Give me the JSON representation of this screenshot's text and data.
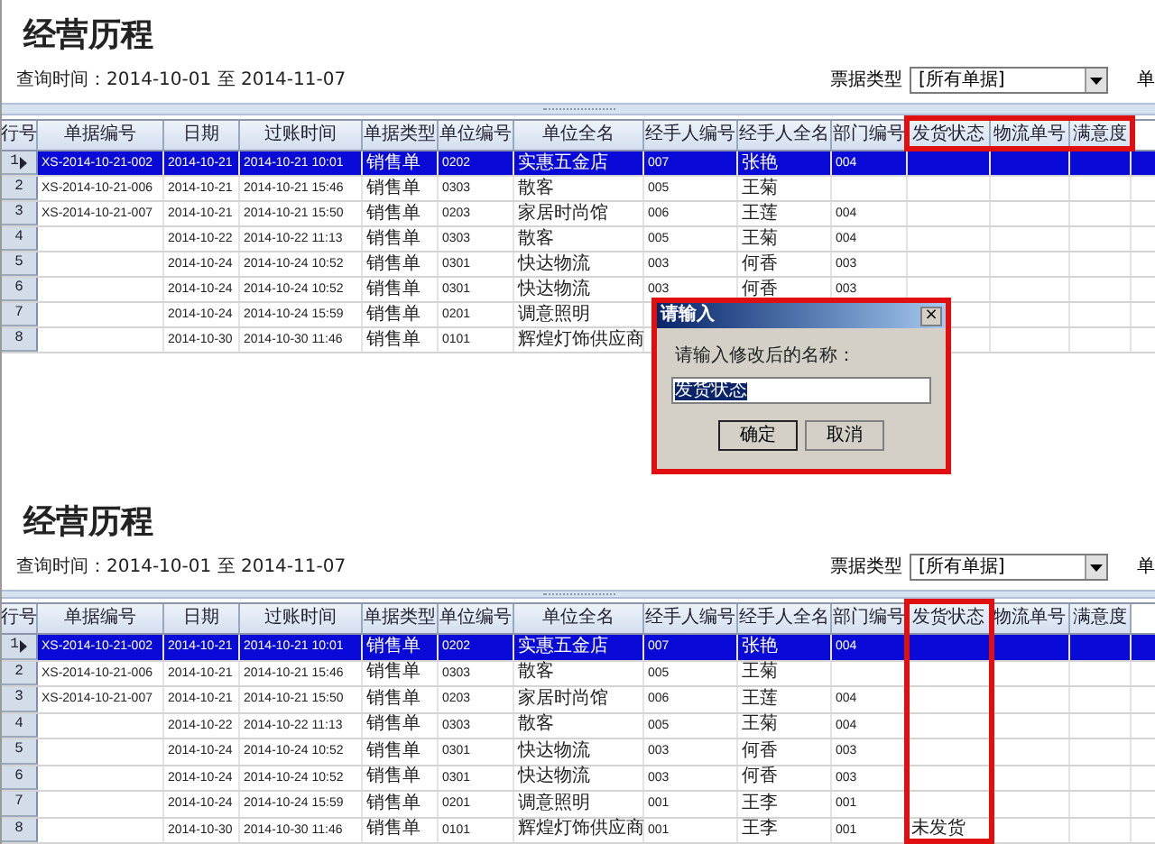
{
  "panels": [
    {
      "title": "经营历程",
      "query": "查询时间：2014-10-01 至 2014-11-07",
      "filter": {
        "label": "票据类型",
        "value": "[所有单据]"
      },
      "cut_label": "单",
      "highlight_covers_rows": false,
      "columns": [
        {
          "label": "行号",
          "highlighted": false
        },
        {
          "label": "单据编号",
          "highlighted": false
        },
        {
          "label": "日期",
          "highlighted": false
        },
        {
          "label": "过账时间",
          "highlighted": false
        },
        {
          "label": "单据类型",
          "highlighted": false
        },
        {
          "label": "单位编号",
          "highlighted": false
        },
        {
          "label": "单位全名",
          "highlighted": false
        },
        {
          "label": "经手人编号",
          "highlighted": false
        },
        {
          "label": "经手人全名",
          "highlighted": false
        },
        {
          "label": "部门编号",
          "highlighted": false
        },
        {
          "label": "发货状态",
          "highlighted": true
        },
        {
          "label": "物流单号",
          "highlighted": true
        },
        {
          "label": "满意度",
          "highlighted": true
        }
      ],
      "rows": [
        {
          "selected": true,
          "cells": [
            "1",
            "XS-2014-10-21-002",
            "2014-10-21",
            "2014-10-21 10:01",
            "销售单",
            "0202",
            "实惠五金店",
            "007",
            "张艳",
            "004"
          ]
        },
        {
          "selected": false,
          "cells": [
            "2",
            "XS-2014-10-21-006",
            "2014-10-21",
            "2014-10-21 15:46",
            "销售单",
            "0303",
            "散客",
            "005",
            "王菊"
          ]
        },
        {
          "selected": false,
          "cells": [
            "3",
            "XS-2014-10-21-007",
            "2014-10-21",
            "2014-10-21 15:50",
            "销售单",
            "0203",
            "家居时尚馆",
            "006",
            "王莲",
            "004"
          ]
        },
        {
          "selected": false,
          "cells": [
            "4",
            null,
            "2014-10-22",
            "2014-10-22 11:13",
            "销售单",
            "0303",
            "散客",
            "005",
            "王菊",
            "004"
          ]
        },
        {
          "selected": false,
          "cells": [
            "5",
            null,
            "2014-10-24",
            "2014-10-24 10:52",
            "销售单",
            "0301",
            "快达物流",
            "003",
            "何香",
            "003"
          ]
        },
        {
          "selected": false,
          "cells": [
            "6",
            null,
            "2014-10-24",
            "2014-10-24 10:52",
            "销售单",
            "0301",
            "快达物流",
            "003",
            "何香",
            "003"
          ]
        },
        {
          "selected": false,
          "cells": [
            "7",
            null,
            "2014-10-24",
            "2014-10-24 15:59",
            "销售单",
            "0201",
            "调意照明"
          ]
        },
        {
          "selected": false,
          "cells": [
            "8",
            null,
            "2014-10-30",
            "2014-10-30 11:46",
            "销售单",
            "0101",
            "辉煌灯饰供应商"
          ]
        }
      ],
      "dialog": {
        "title": "请输入",
        "close": "×",
        "prompt": "请输入修改后的名称：",
        "value": "发货状态",
        "highlighted": true,
        "buttons": [
          "确定",
          "取消"
        ]
      }
    },
    {
      "title": "经营历程",
      "query": "查询时间：2014-10-01 至 2014-11-07",
      "filter": {
        "label": "票据类型",
        "value": "[所有单据]"
      },
      "cut_label": "单",
      "highlight_covers_rows": true,
      "columns": [
        {
          "label": "行号",
          "highlighted": false
        },
        {
          "label": "单据编号",
          "highlighted": false
        },
        {
          "label": "日期",
          "highlighted": false
        },
        {
          "label": "过账时间",
          "highlighted": false
        },
        {
          "label": "单据类型",
          "highlighted": false
        },
        {
          "label": "单位编号",
          "highlighted": false
        },
        {
          "label": "单位全名",
          "highlighted": false
        },
        {
          "label": "经手人编号",
          "highlighted": false
        },
        {
          "label": "经手人全名",
          "highlighted": false
        },
        {
          "label": "部门编号",
          "highlighted": false
        },
        {
          "label": "发货状态",
          "highlighted": true
        },
        {
          "label": "物流单号",
          "highlighted": false
        },
        {
          "label": "满意度",
          "highlighted": false
        }
      ],
      "rows": [
        {
          "selected": true,
          "cells": [
            "1",
            "XS-2014-10-21-002",
            "2014-10-21",
            "2014-10-21 10:01",
            "销售单",
            "0202",
            "实惠五金店",
            "007",
            "张艳",
            "004"
          ]
        },
        {
          "selected": false,
          "cells": [
            "2",
            "XS-2014-10-21-006",
            "2014-10-21",
            "2014-10-21 15:46",
            "销售单",
            "0303",
            "散客",
            "005",
            "王菊"
          ]
        },
        {
          "selected": false,
          "cells": [
            "3",
            "XS-2014-10-21-007",
            "2014-10-21",
            "2014-10-21 15:50",
            "销售单",
            "0203",
            "家居时尚馆",
            "006",
            "王莲",
            "004"
          ]
        },
        {
          "selected": false,
          "cells": [
            "4",
            null,
            "2014-10-22",
            "2014-10-22 11:13",
            "销售单",
            "0303",
            "散客",
            "005",
            "王菊",
            "004"
          ]
        },
        {
          "selected": false,
          "cells": [
            "5",
            null,
            "2014-10-24",
            "2014-10-24 10:52",
            "销售单",
            "0301",
            "快达物流",
            "003",
            "何香",
            "003"
          ]
        },
        {
          "selected": false,
          "cells": [
            "6",
            null,
            "2014-10-24",
            "2014-10-24 10:52",
            "销售单",
            "0301",
            "快达物流",
            "003",
            "何香",
            "003"
          ]
        },
        {
          "selected": false,
          "cells": [
            "7",
            null,
            "2014-10-24",
            "2014-10-24 15:59",
            "销售单",
            "0201",
            "调意照明",
            "001",
            "王李",
            "001"
          ]
        },
        {
          "selected": false,
          "cells": [
            "8",
            null,
            "2014-10-30",
            "2014-10-30 11:46",
            "销售单",
            "0101",
            "辉煌灯饰供应商",
            "001",
            "王李",
            "001",
            "未发货"
          ]
        }
      ]
    }
  ]
}
